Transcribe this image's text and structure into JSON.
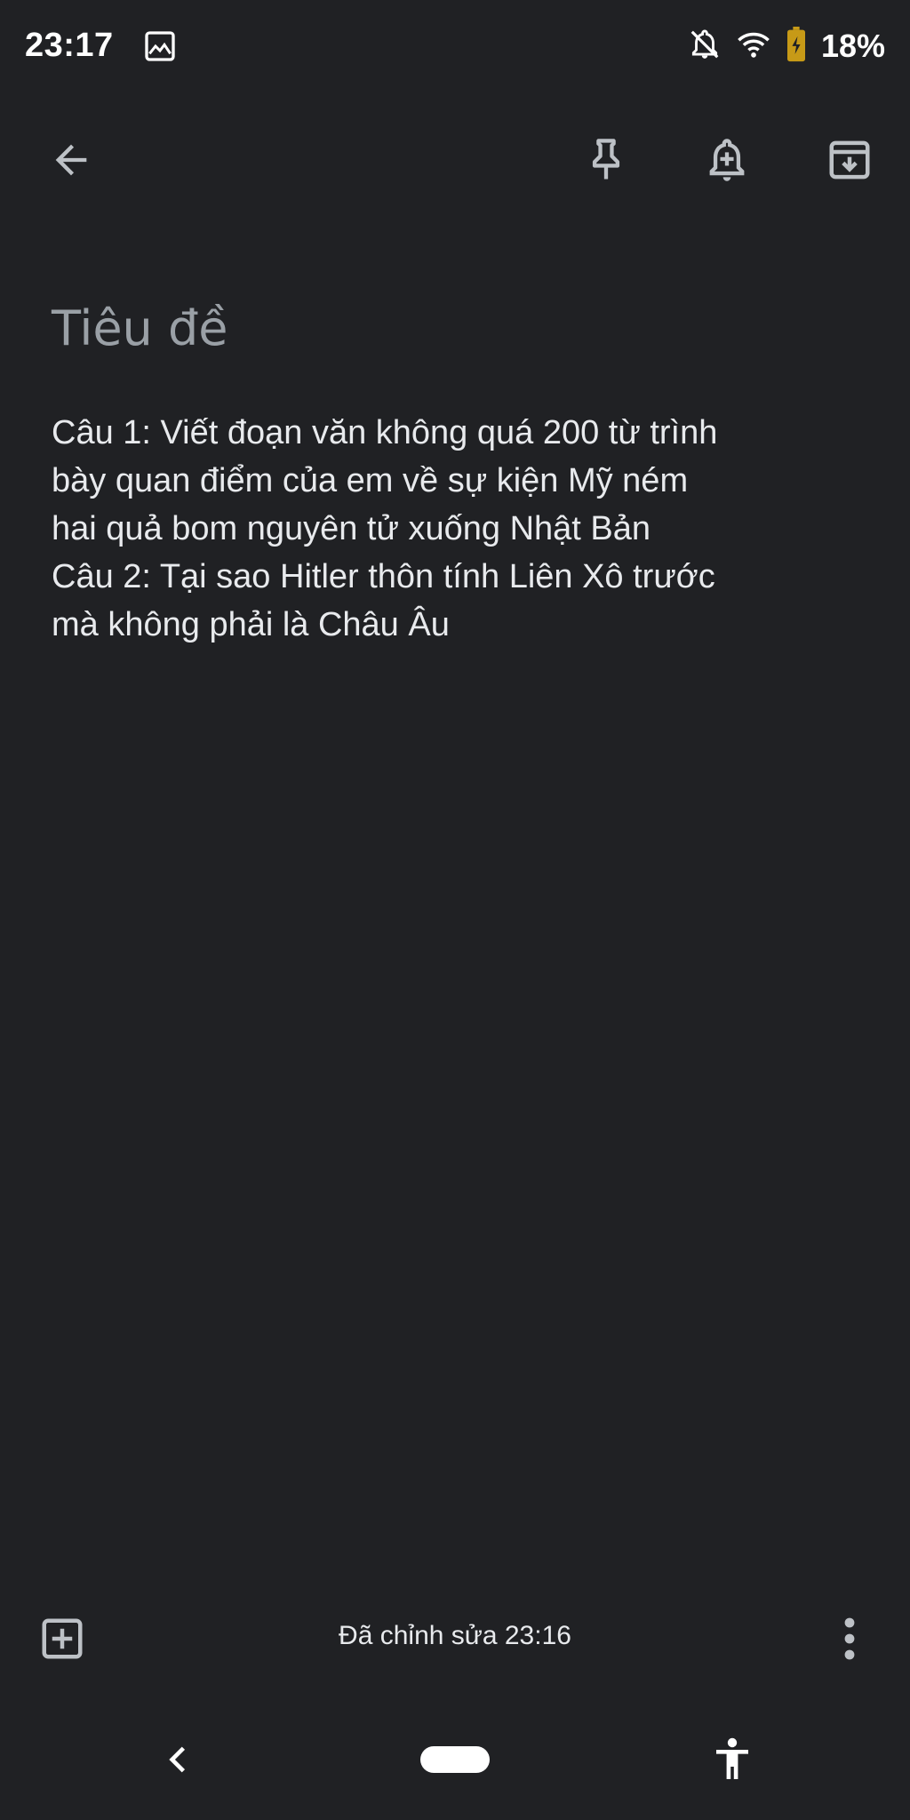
{
  "status_bar": {
    "time": "23:17",
    "battery_percent": "18%",
    "battery_level": 0.18,
    "battery_color": "#c79a17",
    "icons": [
      "gallery-icon",
      "notifications-off-icon",
      "wifi-icon",
      "battery-charging-icon"
    ]
  },
  "toolbar": {
    "icons": [
      "back-arrow-icon",
      "pin-icon",
      "add-reminder-icon",
      "archive-icon"
    ]
  },
  "note": {
    "title_placeholder": "Tiêu đề",
    "lines": [
      "Câu 1: Viết đoạn văn không quá 200 từ trình",
      "bày quan điểm của em về sự kiện Mỹ ném",
      "hai quả bom nguyên tử xuống Nhật Bản",
      "Câu 2: Tại sao Hitler thôn tính Liên Xô trước",
      "mà không phải là Châu Âu"
    ]
  },
  "bottom_bar": {
    "edited_label": "Đã chỉnh sửa 23:16",
    "icons": [
      "add-box-icon",
      "more-vert-icon"
    ]
  },
  "nav_bar": {
    "icons": [
      "nav-back-icon",
      "home-pill",
      "accessibility-icon"
    ]
  },
  "colors": {
    "background": "#202124",
    "text": "#e8eaed",
    "placeholder": "#9aa0a6",
    "icon": "#bdc1c6"
  }
}
